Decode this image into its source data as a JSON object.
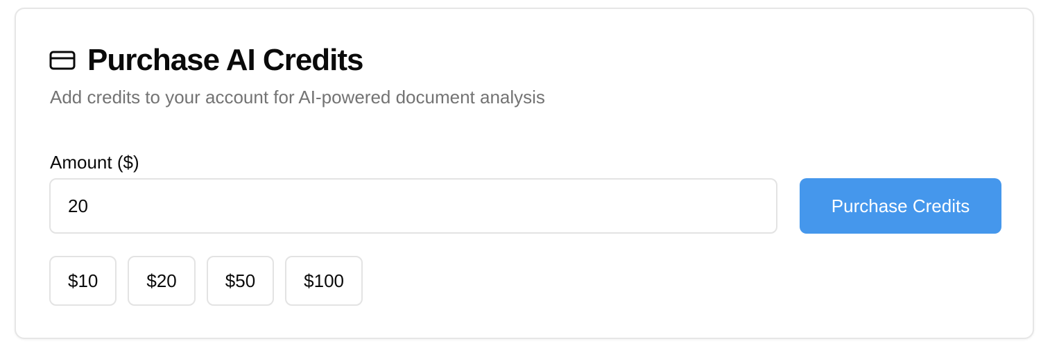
{
  "card": {
    "icon": "credit-card-icon",
    "title": "Purchase AI Credits",
    "subtitle": "Add credits to your account for AI-powered document analysis"
  },
  "form": {
    "amount_label": "Amount ($)",
    "amount_value": "20",
    "purchase_label": "Purchase Credits",
    "presets": [
      "$10",
      "$20",
      "$50",
      "$100"
    ]
  },
  "colors": {
    "primary_button": "#4597ec",
    "border": "#e3e3e3",
    "subtitle_text": "#737373"
  }
}
